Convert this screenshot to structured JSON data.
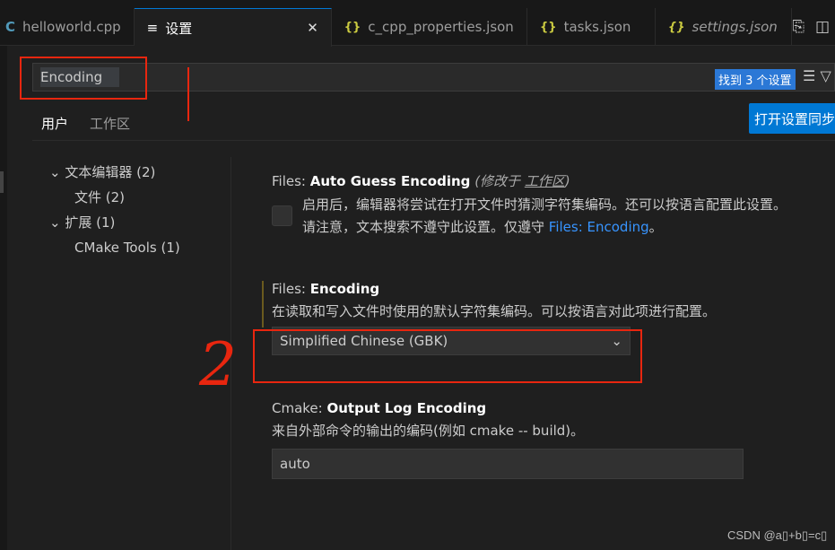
{
  "tabs": [
    {
      "label": "helloworld.cpp",
      "icon": "cpp-file-icon"
    },
    {
      "label": "设置",
      "icon": "settings-list-icon",
      "active": true
    },
    {
      "label": "c_cpp_properties.json",
      "icon": "json-braces-icon"
    },
    {
      "label": "tasks.json",
      "icon": "json-braces-icon"
    },
    {
      "label": "settings.json",
      "icon": "json-braces-icon"
    }
  ],
  "search": {
    "value": "Encoding",
    "result_badge": "找到 3 个设置"
  },
  "scopes": [
    "用户",
    "工作区"
  ],
  "sync_button": "打开设置同步",
  "tree": [
    {
      "label": "文本编辑器 (2)",
      "expanded": true
    },
    {
      "label": "文件 (2)",
      "child": true
    },
    {
      "label": "扩展 (1)",
      "expanded": true
    },
    {
      "label": "CMake Tools (1)",
      "child": true
    }
  ],
  "settings": [
    {
      "category": "Files: ",
      "name": "Auto Guess Encoding",
      "modified_prefix": "(修改于 ",
      "modified_scope": "工作区",
      "modified_suffix": ")",
      "desc1": "启用后，编辑器将尝试在打开文件时猜测字符集编码。还可以按语言配置此设置。",
      "desc2": "请注意，文本搜索不遵守此设置。仅遵守 ",
      "link": "Files: Encoding",
      "desc2_end": "。",
      "checked": false
    },
    {
      "category": "Files: ",
      "name": "Encoding",
      "desc": "在读取和写入文件时使用的默认字符集编码。可以按语言对此项进行配置。",
      "value": "Simplified Chinese (GBK)"
    },
    {
      "category": "Cmake: ",
      "name": "Output Log Encoding",
      "desc": "来自外部命令的输出的编码(例如 cmake -- build)。",
      "value": "auto"
    }
  ],
  "annotation_number": "2",
  "watermark": "CSDN @a▯+b▯=c▯",
  "colors": {
    "accent": "#0078d4",
    "annotation": "#e8260f",
    "link": "#3794ff"
  }
}
